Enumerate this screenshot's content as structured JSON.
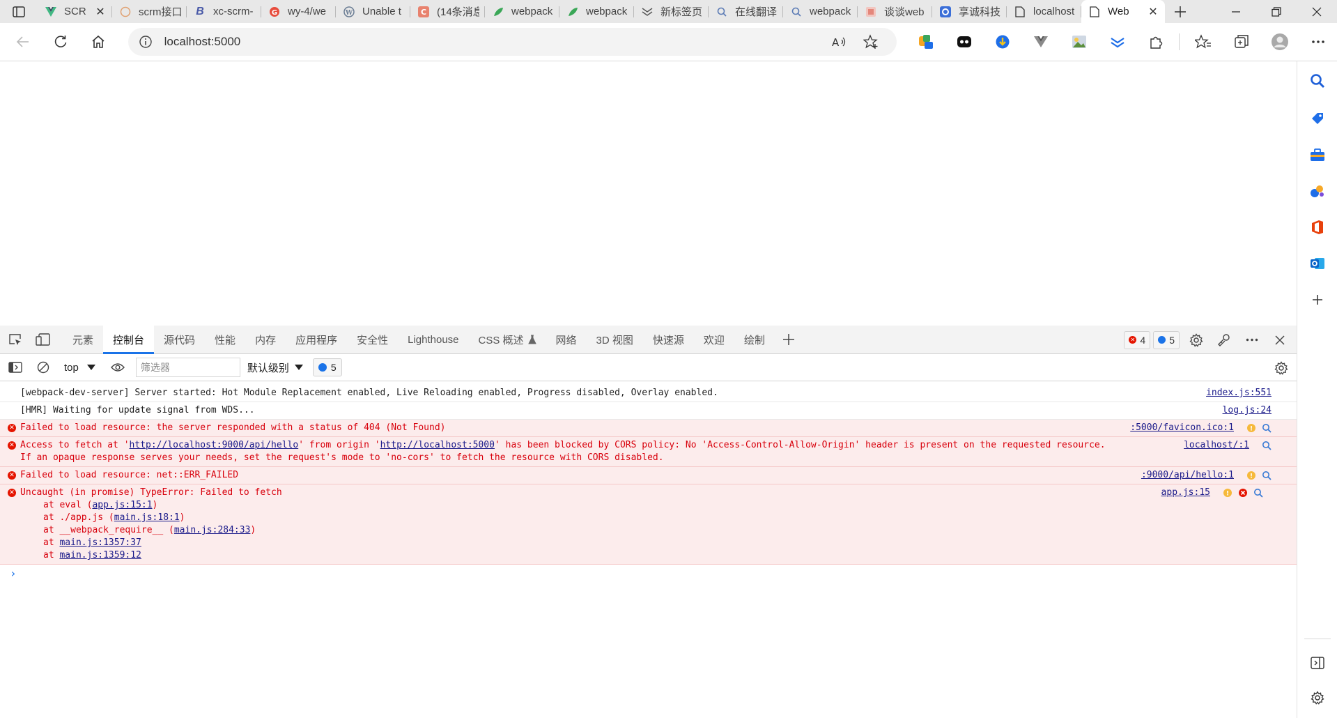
{
  "tabs": [
    {
      "title": "SCR",
      "favicon": "vue-v-icon"
    },
    {
      "title": "scrm接口",
      "favicon": "circle-site-icon"
    },
    {
      "title": "xc-scrm-",
      "favicon": "b-letter-icon"
    },
    {
      "title": "wy-4/we",
      "favicon": "g-letter-icon"
    },
    {
      "title": "Unable t",
      "favicon": "wordpress-icon"
    },
    {
      "title": "(14条消息",
      "favicon": "c-letter-icon"
    },
    {
      "title": "webpack",
      "favicon": "leaf-icon"
    },
    {
      "title": "webpack",
      "favicon": "leaf-icon"
    },
    {
      "title": "新标签页",
      "favicon": "newtab-icon"
    },
    {
      "title": "在线翻译",
      "favicon": "search-icon"
    },
    {
      "title": "webpack",
      "favicon": "search-icon"
    },
    {
      "title": "谈谈web",
      "favicon": "image-icon"
    },
    {
      "title": "享诚科技",
      "favicon": "app-icon"
    },
    {
      "title": "localhost",
      "favicon": "page-icon"
    },
    {
      "title": "Web",
      "favicon": "page-icon",
      "active": true
    }
  ],
  "address": {
    "url": "localhost:5000"
  },
  "devtools": {
    "tabs": [
      "元素",
      "控制台",
      "源代码",
      "性能",
      "内存",
      "应用程序",
      "安全性",
      "Lighthouse",
      "CSS 概述",
      "网络",
      "3D 视图",
      "快速源",
      "欢迎",
      "绘制"
    ],
    "active_tab": "控制台",
    "error_count": "4",
    "issue_count": "5",
    "context": "top",
    "filter_placeholder": "筛选器",
    "level": "默认级别",
    "issues_badge": "5",
    "messages": [
      {
        "type": "log",
        "text": "[webpack-dev-server] Server started: Hot Module Replacement enabled, Live Reloading enabled, Progress disabled, Overlay enabled.",
        "source": "index.js:551"
      },
      {
        "type": "log",
        "text": "[HMR] Waiting for update signal from WDS...",
        "source": "log.js:24"
      },
      {
        "type": "error",
        "text": "Failed to load resource: the server responded with a status of 404 (Not Found)",
        "source": ":5000/favicon.ico:1"
      },
      {
        "type": "error",
        "text_pre": "Access to fetch at '",
        "link1": "http://localhost:9000/api/hello",
        "text_mid": "' from origin '",
        "link2": "http://localhost:5000",
        "text_post": "' has been blocked by CORS policy: No 'Access-Control-Allow-Origin' header is present on the requested resource.",
        "text_line2": "If an opaque response serves your needs, set the request's mode to 'no-cors' to fetch the resource with CORS disabled.",
        "source": "localhost/:1"
      },
      {
        "type": "error",
        "text": "Failed to load resource: net::ERR_FAILED",
        "source": ":9000/api/hello:1"
      },
      {
        "type": "error",
        "text": "Uncaught (in promise) TypeError: Failed to fetch",
        "source": "app.js:15",
        "stack": [
          {
            "pre": "at eval (",
            "link": "app.js:15:1",
            "post": ")"
          },
          {
            "pre": "at ./app.js (",
            "link": "main.js:18:1",
            "post": ")"
          },
          {
            "pre": "at __webpack_require__ (",
            "link": "main.js:284:33",
            "post": ")"
          },
          {
            "pre": "at ",
            "link": "main.js:1357:37",
            "post": ""
          },
          {
            "pre": "at ",
            "link": "main.js:1359:12",
            "post": ""
          }
        ]
      }
    ]
  },
  "colors": {
    "accent": "#1a73e8",
    "error": "#e51400",
    "error_bg": "#fcecec"
  }
}
